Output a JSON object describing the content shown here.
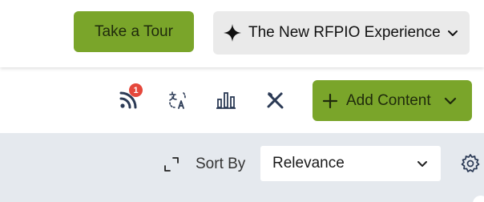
{
  "header": {
    "tour_label": "Take a Tour",
    "experience_label": "The New RFPIO Experience"
  },
  "toolbar": {
    "feed_badge": "1",
    "add_content_label": "Add Content",
    "icons": [
      "rss-feed-icon",
      "translate-icon",
      "bar-chart-icon",
      "tools-icon"
    ]
  },
  "sort": {
    "label": "Sort By",
    "selected": "Relevance"
  },
  "colors": {
    "accent_green": "#7aa52a",
    "badge_red": "#e5473b",
    "icon_navy": "#2b3a55",
    "sortbar_bg": "#e5e9ee"
  }
}
